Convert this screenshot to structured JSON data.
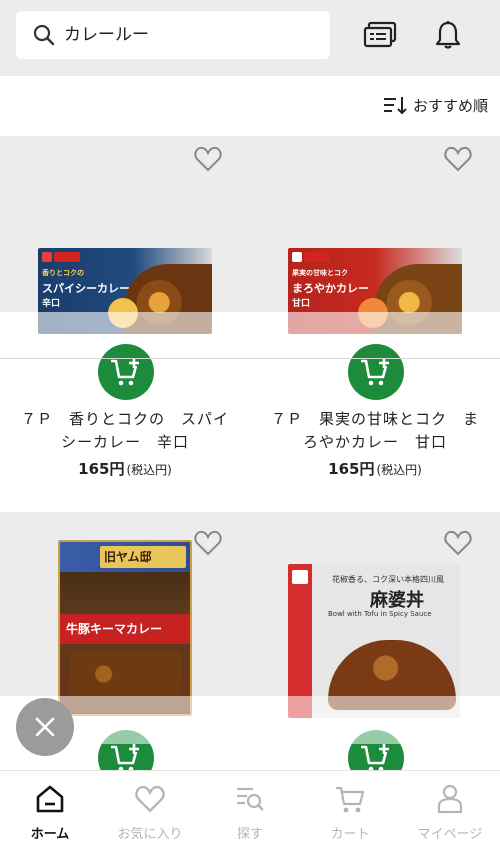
{
  "search": {
    "value": "カレールー",
    "icon": "search-icon"
  },
  "header": {
    "icons": [
      "receipt-icon",
      "bell-icon"
    ]
  },
  "sort": {
    "label": "おすすめ順",
    "icon": "sort-icon"
  },
  "products": [
    {
      "name": "７Ｐ　香りとコクの　スパイシーカレー　辛口",
      "price": "165円",
      "tax": "(税込円)",
      "package": {
        "subtitle": "香りとコクの",
        "title": "スパイシーカレー",
        "level": "辛口"
      }
    },
    {
      "name": "７Ｐ　果実の甘味とコク　まろやかカレー　甘口",
      "price": "165円",
      "tax": "(税込円)",
      "package": {
        "subtitle": "果実の甘味とコク",
        "title": "まろやかカレー",
        "level": "甘口"
      }
    },
    {
      "name": "",
      "package": {
        "sign": "旧ヤム邸",
        "title": "牛豚キーマカレー"
      }
    },
    {
      "name": "",
      "package": {
        "line1": "花椒香る、コク深い本格四川風",
        "title": "麻婆丼",
        "line2": "Bowl with Tofu in Spicy Sauce"
      }
    }
  ],
  "bottom_nav": [
    {
      "label": "ホーム",
      "icon": "home-icon",
      "active": true
    },
    {
      "label": "お気に入り",
      "icon": "heart-icon",
      "active": false
    },
    {
      "label": "探す",
      "icon": "search-list-icon",
      "active": false
    },
    {
      "label": "カート",
      "icon": "cart-icon",
      "active": false
    },
    {
      "label": "マイページ",
      "icon": "person-icon",
      "active": false
    }
  ],
  "colors": {
    "accent": "#1c8c3c",
    "background_band": "#ececec",
    "inactive": "#b5b5b5"
  }
}
